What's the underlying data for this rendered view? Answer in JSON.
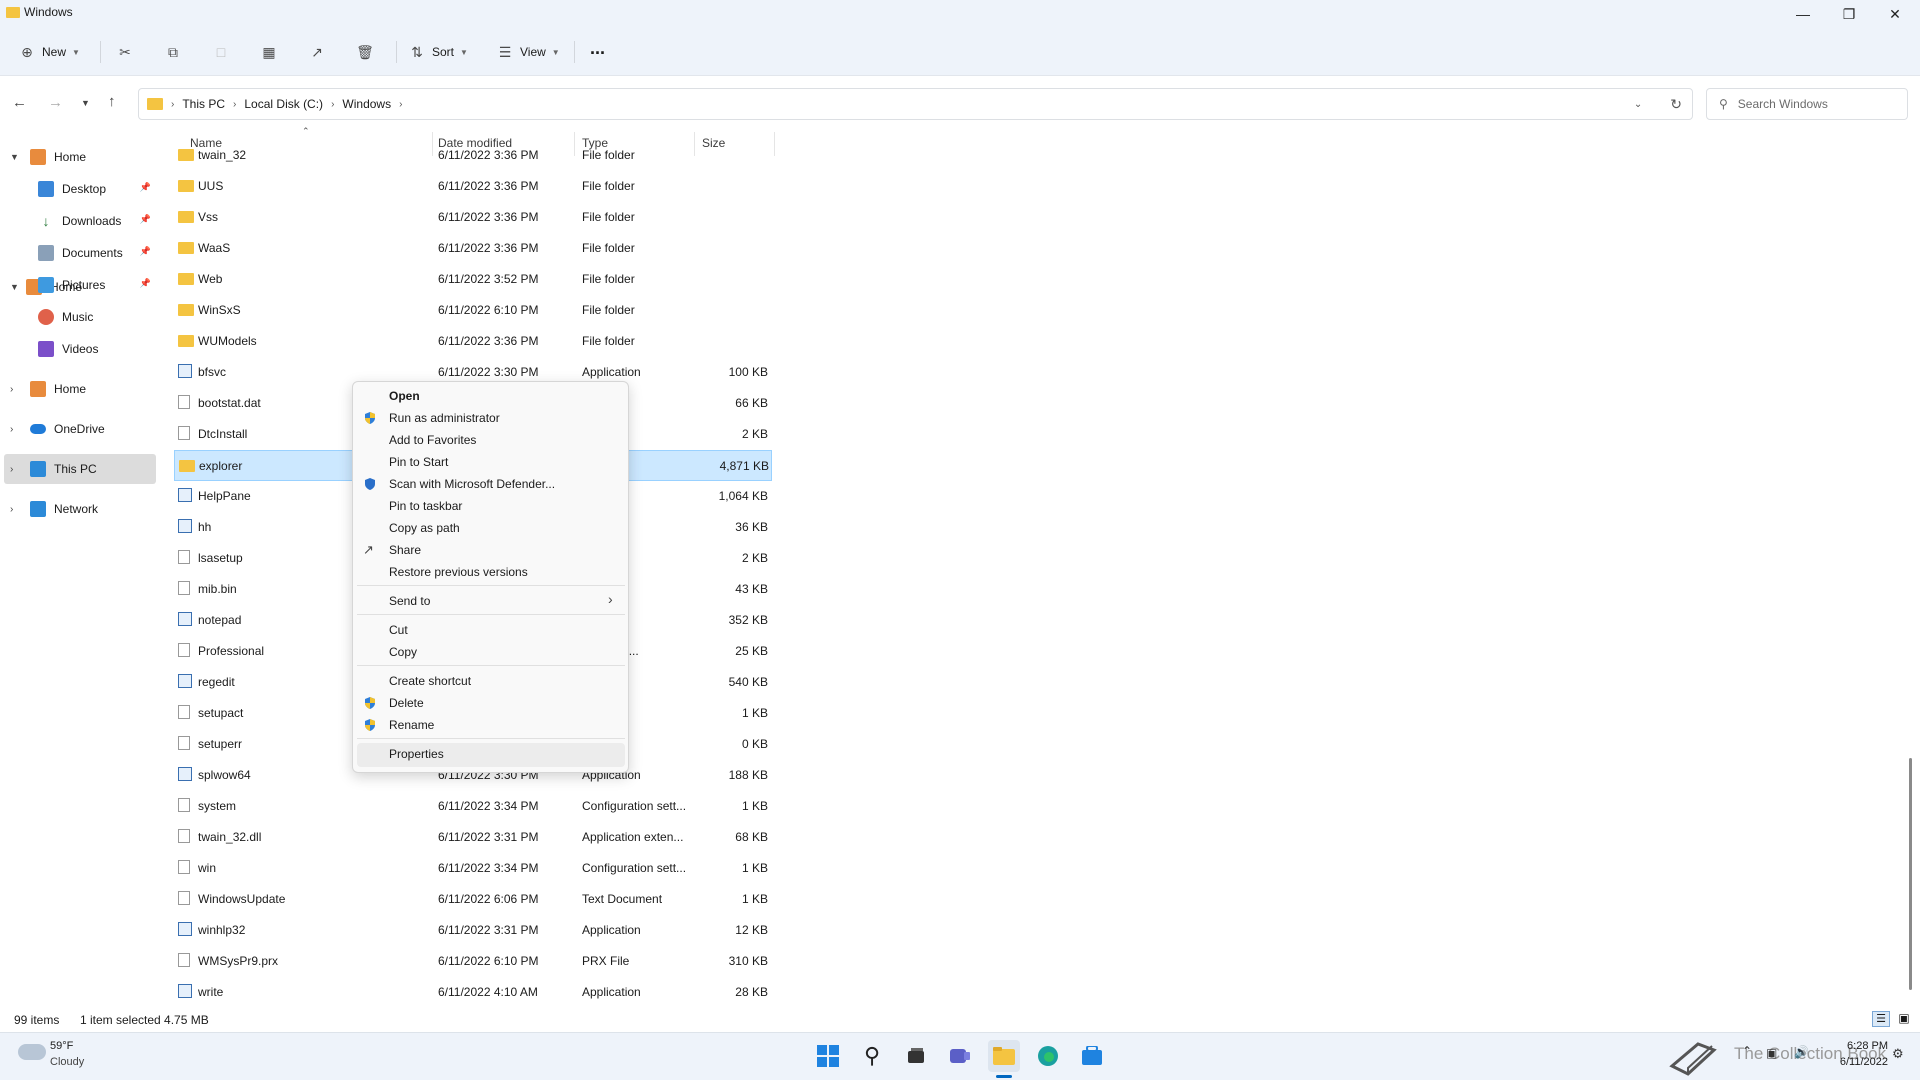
{
  "window": {
    "title": "Windows"
  },
  "cmd": {
    "new": "New",
    "sort": "Sort",
    "view": "View",
    "more": "..."
  },
  "address": {
    "crumbs": [
      "This PC",
      "Local Disk (C:)",
      "Windows"
    ],
    "search_placeholder": "Search Windows"
  },
  "sidebar": {
    "quick": [
      {
        "label": "Home"
      },
      {
        "label": "Desktop"
      },
      {
        "label": "Downloads"
      },
      {
        "label": "Documents"
      },
      {
        "label": "Pictures"
      },
      {
        "label": "Music"
      },
      {
        "label": "Videos"
      }
    ],
    "tree": [
      {
        "label": "Home"
      },
      {
        "label": "OneDrive"
      },
      {
        "label": "This PC"
      },
      {
        "label": "Network"
      }
    ]
  },
  "columns": {
    "name": "Name",
    "date": "Date modified",
    "type": "Type",
    "size": "Size"
  },
  "files": [
    {
      "name": "twain_32",
      "date": "6/11/2022 3:36 PM",
      "type": "File folder",
      "size": ""
    },
    {
      "name": "UUS",
      "date": "6/11/2022 3:36 PM",
      "type": "File folder",
      "size": ""
    },
    {
      "name": "Vss",
      "date": "6/11/2022 3:36 PM",
      "type": "File folder",
      "size": ""
    },
    {
      "name": "WaaS",
      "date": "6/11/2022 3:36 PM",
      "type": "File folder",
      "size": ""
    },
    {
      "name": "Web",
      "date": "6/11/2022 3:52 PM",
      "type": "File folder",
      "size": ""
    },
    {
      "name": "WinSxS",
      "date": "6/11/2022 6:10 PM",
      "type": "File folder",
      "size": ""
    },
    {
      "name": "WUModels",
      "date": "6/11/2022 3:36 PM",
      "type": "File folder",
      "size": ""
    },
    {
      "name": "bfsvc",
      "date": "6/11/2022 3:30 PM",
      "type": "Application",
      "size": "100 KB"
    },
    {
      "name": "bootstat.dat",
      "date": "",
      "type": "",
      "size": "66 KB"
    },
    {
      "name": "DtcInstall",
      "date": "",
      "type": "ument",
      "size": "2 KB"
    },
    {
      "name": "explorer",
      "date": "",
      "type": "on",
      "size": "4,871 KB"
    },
    {
      "name": "HelpPane",
      "date": "",
      "type": "on",
      "size": "1,064 KB"
    },
    {
      "name": "hh",
      "date": "",
      "type": "on",
      "size": "36 KB"
    },
    {
      "name": "lsasetup",
      "date": "",
      "type": "ument",
      "size": "2 KB"
    },
    {
      "name": "mib.bin",
      "date": "",
      "type": "",
      "size": "43 KB"
    },
    {
      "name": "notepad",
      "date": "",
      "type": "on",
      "size": "352 KB"
    },
    {
      "name": "Professional",
      "date": "",
      "type": "t Edge H...",
      "size": "25 KB"
    },
    {
      "name": "regedit",
      "date": "",
      "type": "on",
      "size": "540 KB"
    },
    {
      "name": "setupact",
      "date": "",
      "type": "ument",
      "size": "1 KB"
    },
    {
      "name": "setuperr",
      "date": "",
      "type": "ument",
      "size": "0 KB"
    },
    {
      "name": "splwow64",
      "date": "6/11/2022 3:30 PM",
      "type": "Application",
      "size": "188 KB"
    },
    {
      "name": "system",
      "date": "6/11/2022 3:34 PM",
      "type": "Configuration sett...",
      "size": "1 KB"
    },
    {
      "name": "twain_32.dll",
      "date": "6/11/2022 3:31 PM",
      "type": "Application exten...",
      "size": "68 KB"
    },
    {
      "name": "win",
      "date": "6/11/2022 3:34 PM",
      "type": "Configuration sett...",
      "size": "1 KB"
    },
    {
      "name": "WindowsUpdate",
      "date": "6/11/2022 6:06 PM",
      "type": "Text Document",
      "size": "1 KB"
    },
    {
      "name": "winhlp32",
      "date": "6/11/2022 3:31 PM",
      "type": "Application",
      "size": "12 KB"
    },
    {
      "name": "WMSysPr9.prx",
      "date": "6/11/2022 6:10 PM",
      "type": "PRX File",
      "size": "310 KB"
    },
    {
      "name": "write",
      "date": "6/11/2022 4:10 AM",
      "type": "Application",
      "size": "28 KB"
    }
  ],
  "context_menu": {
    "open": "Open",
    "run_admin": "Run as administrator",
    "favorites": "Add to Favorites",
    "pin_start": "Pin to Start",
    "scan": "Scan with Microsoft Defender...",
    "pin_taskbar": "Pin to taskbar",
    "copy_path": "Copy as path",
    "share": "Share",
    "restore": "Restore previous versions",
    "send_to": "Send to",
    "cut": "Cut",
    "copy": "Copy",
    "shortcut": "Create shortcut",
    "delete": "Delete",
    "rename": "Rename",
    "properties": "Properties"
  },
  "status": {
    "items": "99 items",
    "selected": "1 item selected  4.75 MB"
  },
  "taskbar": {
    "weather_temp": "59°F",
    "weather_desc": "Cloudy",
    "time": "6:28 PM",
    "date": "6/11/2022",
    "watermark": "The Collection Book"
  },
  "colors": {
    "accent": "#0067c0",
    "folder": "#f4c441",
    "selection": "#cce8ff"
  }
}
